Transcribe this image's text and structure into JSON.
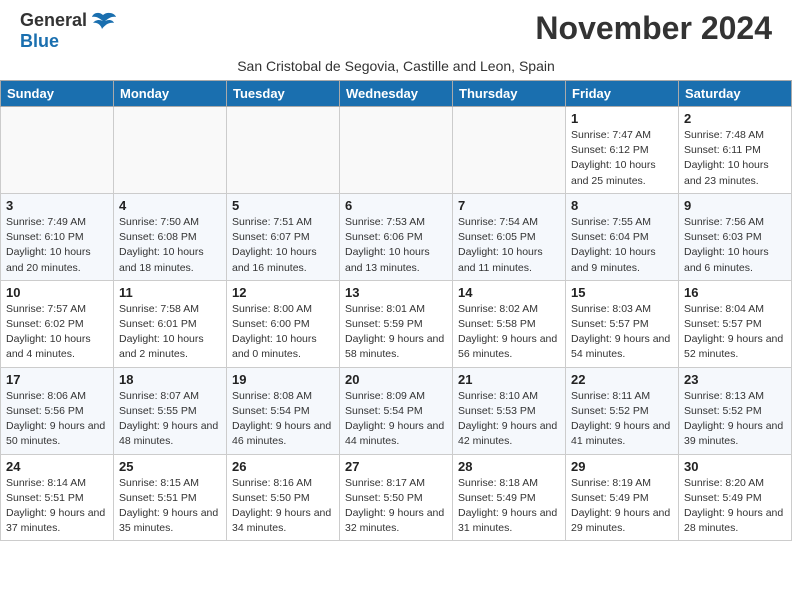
{
  "header": {
    "logo_general": "General",
    "logo_blue": "Blue",
    "month_title": "November 2024",
    "location": "San Cristobal de Segovia, Castille and Leon, Spain"
  },
  "columns": [
    "Sunday",
    "Monday",
    "Tuesday",
    "Wednesday",
    "Thursday",
    "Friday",
    "Saturday"
  ],
  "weeks": [
    [
      {
        "day": "",
        "info": ""
      },
      {
        "day": "",
        "info": ""
      },
      {
        "day": "",
        "info": ""
      },
      {
        "day": "",
        "info": ""
      },
      {
        "day": "",
        "info": ""
      },
      {
        "day": "1",
        "info": "Sunrise: 7:47 AM\nSunset: 6:12 PM\nDaylight: 10 hours and 25 minutes."
      },
      {
        "day": "2",
        "info": "Sunrise: 7:48 AM\nSunset: 6:11 PM\nDaylight: 10 hours and 23 minutes."
      }
    ],
    [
      {
        "day": "3",
        "info": "Sunrise: 7:49 AM\nSunset: 6:10 PM\nDaylight: 10 hours and 20 minutes."
      },
      {
        "day": "4",
        "info": "Sunrise: 7:50 AM\nSunset: 6:08 PM\nDaylight: 10 hours and 18 minutes."
      },
      {
        "day": "5",
        "info": "Sunrise: 7:51 AM\nSunset: 6:07 PM\nDaylight: 10 hours and 16 minutes."
      },
      {
        "day": "6",
        "info": "Sunrise: 7:53 AM\nSunset: 6:06 PM\nDaylight: 10 hours and 13 minutes."
      },
      {
        "day": "7",
        "info": "Sunrise: 7:54 AM\nSunset: 6:05 PM\nDaylight: 10 hours and 11 minutes."
      },
      {
        "day": "8",
        "info": "Sunrise: 7:55 AM\nSunset: 6:04 PM\nDaylight: 10 hours and 9 minutes."
      },
      {
        "day": "9",
        "info": "Sunrise: 7:56 AM\nSunset: 6:03 PM\nDaylight: 10 hours and 6 minutes."
      }
    ],
    [
      {
        "day": "10",
        "info": "Sunrise: 7:57 AM\nSunset: 6:02 PM\nDaylight: 10 hours and 4 minutes."
      },
      {
        "day": "11",
        "info": "Sunrise: 7:58 AM\nSunset: 6:01 PM\nDaylight: 10 hours and 2 minutes."
      },
      {
        "day": "12",
        "info": "Sunrise: 8:00 AM\nSunset: 6:00 PM\nDaylight: 10 hours and 0 minutes."
      },
      {
        "day": "13",
        "info": "Sunrise: 8:01 AM\nSunset: 5:59 PM\nDaylight: 9 hours and 58 minutes."
      },
      {
        "day": "14",
        "info": "Sunrise: 8:02 AM\nSunset: 5:58 PM\nDaylight: 9 hours and 56 minutes."
      },
      {
        "day": "15",
        "info": "Sunrise: 8:03 AM\nSunset: 5:57 PM\nDaylight: 9 hours and 54 minutes."
      },
      {
        "day": "16",
        "info": "Sunrise: 8:04 AM\nSunset: 5:57 PM\nDaylight: 9 hours and 52 minutes."
      }
    ],
    [
      {
        "day": "17",
        "info": "Sunrise: 8:06 AM\nSunset: 5:56 PM\nDaylight: 9 hours and 50 minutes."
      },
      {
        "day": "18",
        "info": "Sunrise: 8:07 AM\nSunset: 5:55 PM\nDaylight: 9 hours and 48 minutes."
      },
      {
        "day": "19",
        "info": "Sunrise: 8:08 AM\nSunset: 5:54 PM\nDaylight: 9 hours and 46 minutes."
      },
      {
        "day": "20",
        "info": "Sunrise: 8:09 AM\nSunset: 5:54 PM\nDaylight: 9 hours and 44 minutes."
      },
      {
        "day": "21",
        "info": "Sunrise: 8:10 AM\nSunset: 5:53 PM\nDaylight: 9 hours and 42 minutes."
      },
      {
        "day": "22",
        "info": "Sunrise: 8:11 AM\nSunset: 5:52 PM\nDaylight: 9 hours and 41 minutes."
      },
      {
        "day": "23",
        "info": "Sunrise: 8:13 AM\nSunset: 5:52 PM\nDaylight: 9 hours and 39 minutes."
      }
    ],
    [
      {
        "day": "24",
        "info": "Sunrise: 8:14 AM\nSunset: 5:51 PM\nDaylight: 9 hours and 37 minutes."
      },
      {
        "day": "25",
        "info": "Sunrise: 8:15 AM\nSunset: 5:51 PM\nDaylight: 9 hours and 35 minutes."
      },
      {
        "day": "26",
        "info": "Sunrise: 8:16 AM\nSunset: 5:50 PM\nDaylight: 9 hours and 34 minutes."
      },
      {
        "day": "27",
        "info": "Sunrise: 8:17 AM\nSunset: 5:50 PM\nDaylight: 9 hours and 32 minutes."
      },
      {
        "day": "28",
        "info": "Sunrise: 8:18 AM\nSunset: 5:49 PM\nDaylight: 9 hours and 31 minutes."
      },
      {
        "day": "29",
        "info": "Sunrise: 8:19 AM\nSunset: 5:49 PM\nDaylight: 9 hours and 29 minutes."
      },
      {
        "day": "30",
        "info": "Sunrise: 8:20 AM\nSunset: 5:49 PM\nDaylight: 9 hours and 28 minutes."
      }
    ]
  ]
}
